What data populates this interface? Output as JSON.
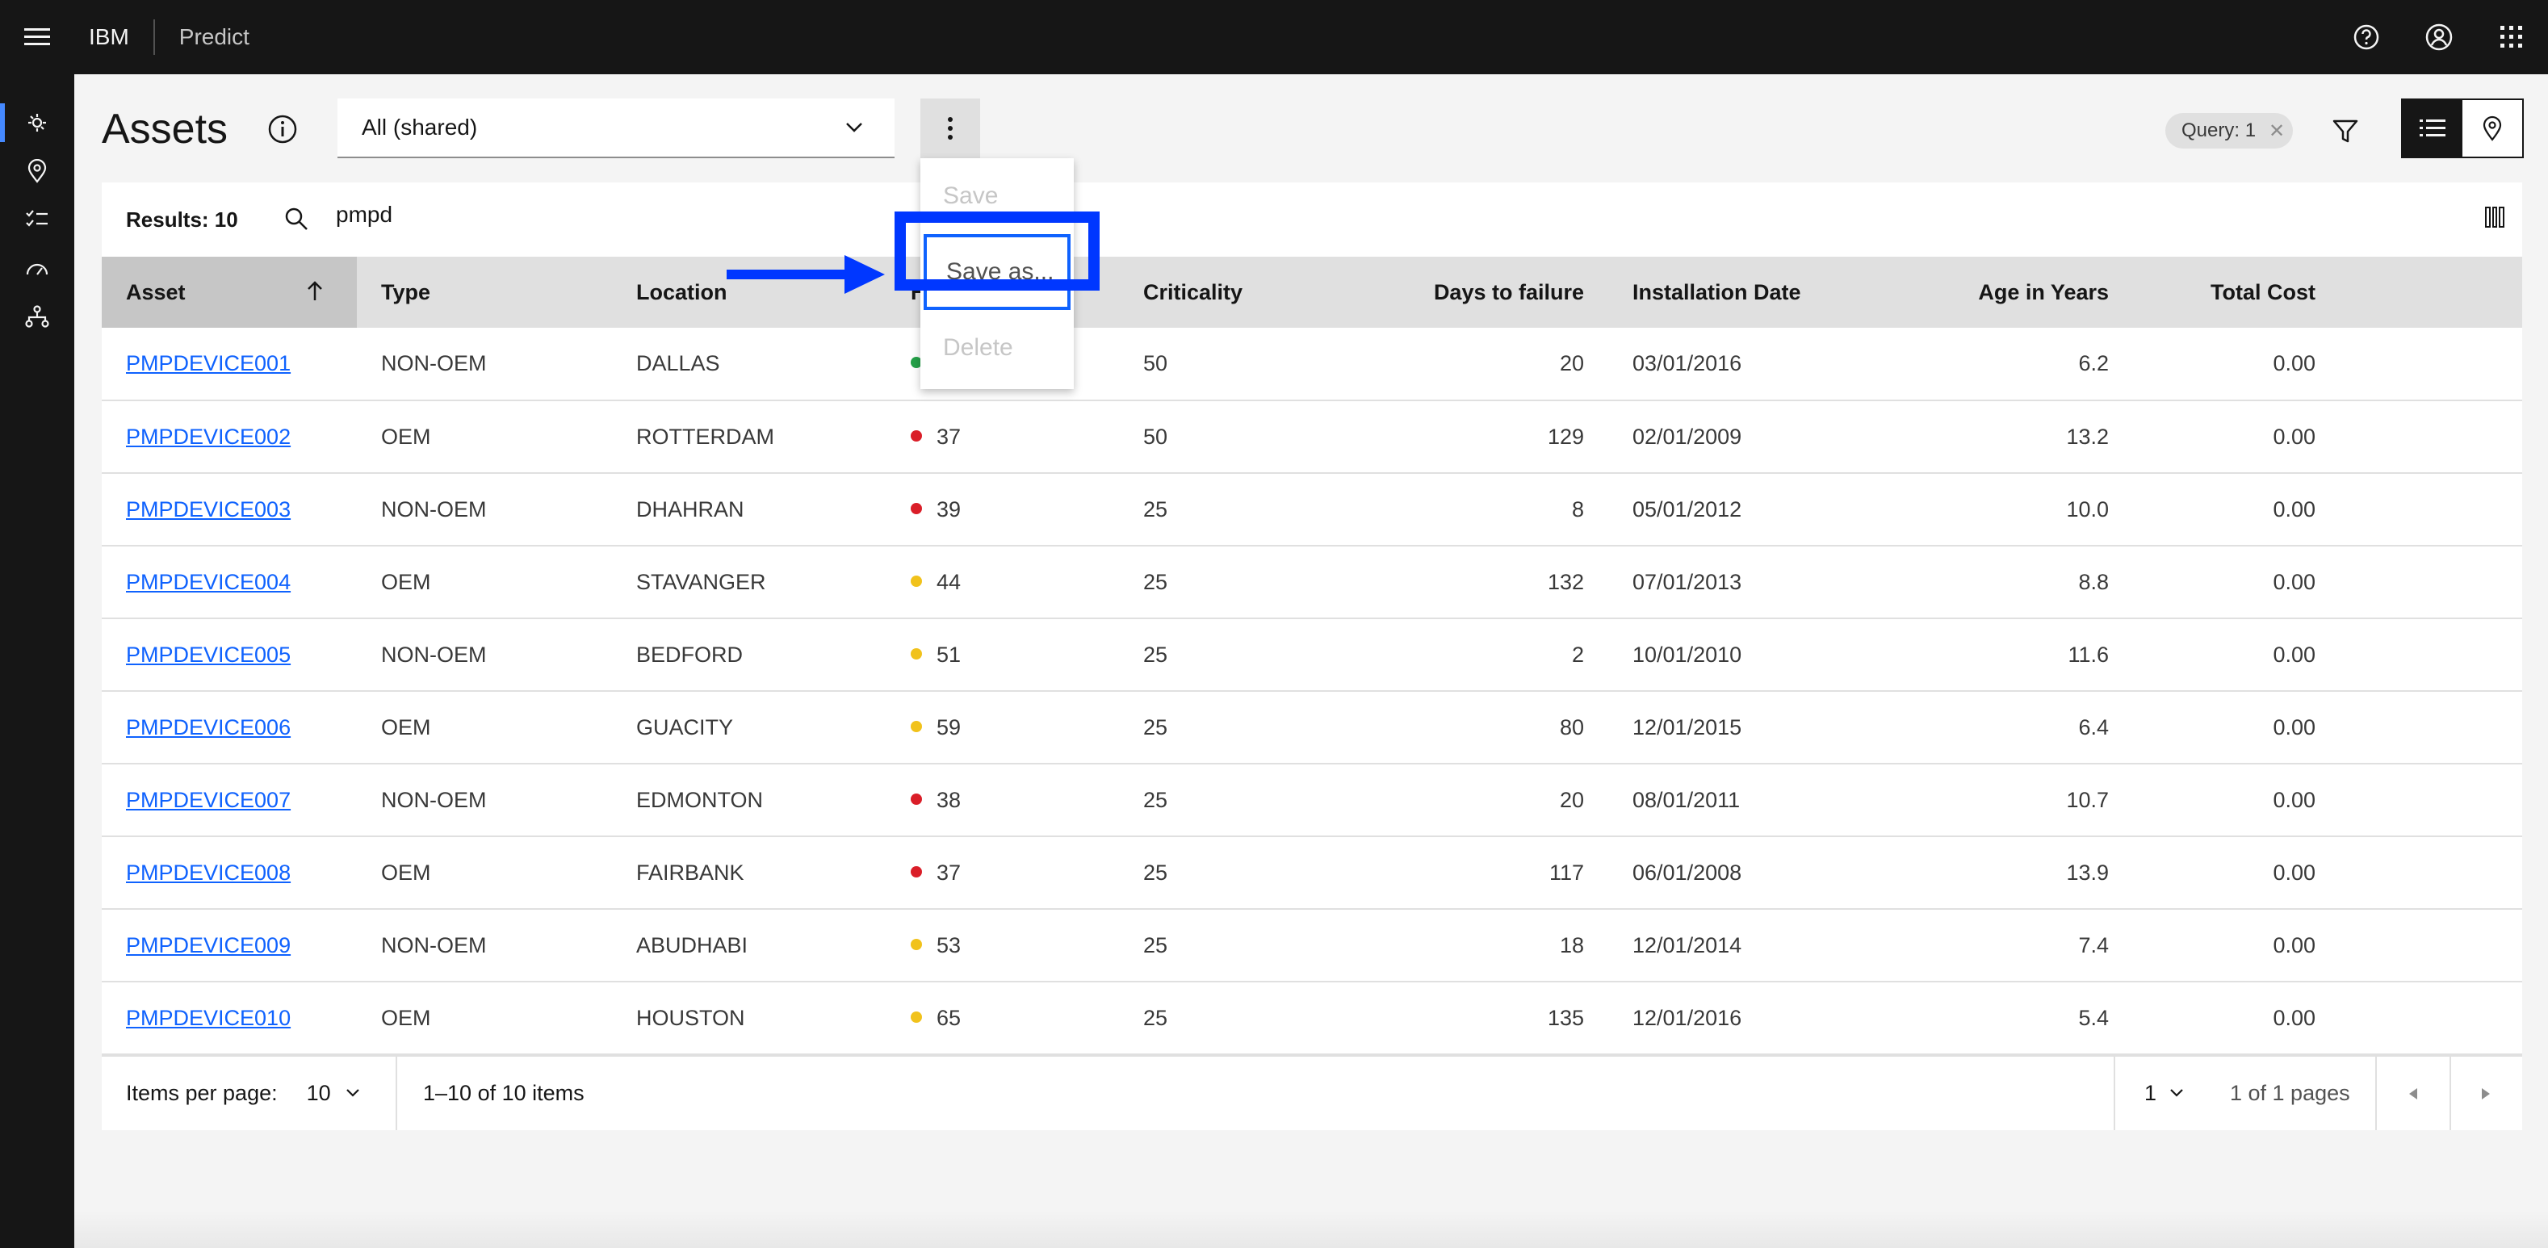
{
  "topbar": {
    "brand": "IBM",
    "product": "Predict",
    "icons": [
      "menu-icon",
      "help-icon",
      "user-icon",
      "app-switcher-icon"
    ]
  },
  "sidenav": {
    "icons": [
      "assets-icon",
      "location-icon",
      "checklist-icon",
      "gauge-icon",
      "hierarchy-icon"
    ]
  },
  "page": {
    "title": "Assets"
  },
  "view_select": {
    "value": "All (shared)"
  },
  "overflow_menu": {
    "items": [
      "Save",
      "Save as...",
      "Delete"
    ]
  },
  "query_tag": {
    "label": "Query: 1"
  },
  "toolbar": {
    "results": "Results: 10",
    "search_value": "pmpd"
  },
  "table": {
    "headers": [
      "Asset",
      "Type",
      "Location",
      "Health",
      "Criticality",
      "Days to failure",
      "Installation Date",
      "Age in Years",
      "Total Cost"
    ],
    "rows": [
      {
        "asset": "PMPDEVICE001",
        "type": "NON-OEM",
        "location": "DALLAS",
        "health": "",
        "status": "green",
        "criticality": "50",
        "days": "20",
        "date": "03/01/2016",
        "age": "6.2",
        "cost": "0.00"
      },
      {
        "asset": "PMPDEVICE002",
        "type": "OEM",
        "location": "ROTTERDAM",
        "health": "37",
        "status": "red",
        "criticality": "50",
        "days": "129",
        "date": "02/01/2009",
        "age": "13.2",
        "cost": "0.00"
      },
      {
        "asset": "PMPDEVICE003",
        "type": "NON-OEM",
        "location": "DHAHRAN",
        "health": "39",
        "status": "red",
        "criticality": "25",
        "days": "8",
        "date": "05/01/2012",
        "age": "10.0",
        "cost": "0.00"
      },
      {
        "asset": "PMPDEVICE004",
        "type": "OEM",
        "location": "STAVANGER",
        "health": "44",
        "status": "yellow",
        "criticality": "25",
        "days": "132",
        "date": "07/01/2013",
        "age": "8.8",
        "cost": "0.00"
      },
      {
        "asset": "PMPDEVICE005",
        "type": "NON-OEM",
        "location": "BEDFORD",
        "health": "51",
        "status": "yellow",
        "criticality": "25",
        "days": "2",
        "date": "10/01/2010",
        "age": "11.6",
        "cost": "0.00"
      },
      {
        "asset": "PMPDEVICE006",
        "type": "OEM",
        "location": "GUACITY",
        "health": "59",
        "status": "yellow",
        "criticality": "25",
        "days": "80",
        "date": "12/01/2015",
        "age": "6.4",
        "cost": "0.00"
      },
      {
        "asset": "PMPDEVICE007",
        "type": "NON-OEM",
        "location": "EDMONTON",
        "health": "38",
        "status": "red",
        "criticality": "25",
        "days": "20",
        "date": "08/01/2011",
        "age": "10.7",
        "cost": "0.00"
      },
      {
        "asset": "PMPDEVICE008",
        "type": "OEM",
        "location": "FAIRBANK",
        "health": "37",
        "status": "red",
        "criticality": "25",
        "days": "117",
        "date": "06/01/2008",
        "age": "13.9",
        "cost": "0.00"
      },
      {
        "asset": "PMPDEVICE009",
        "type": "NON-OEM",
        "location": "ABUDHABI",
        "health": "53",
        "status": "yellow",
        "criticality": "25",
        "days": "18",
        "date": "12/01/2014",
        "age": "7.4",
        "cost": "0.00"
      },
      {
        "asset": "PMPDEVICE010",
        "type": "OEM",
        "location": "HOUSTON",
        "health": "65",
        "status": "yellow",
        "criticality": "25",
        "days": "135",
        "date": "12/01/2016",
        "age": "5.4",
        "cost": "0.00"
      }
    ]
  },
  "pagination": {
    "items_per_page_label": "Items per page:",
    "items_per_page": "10",
    "range": "1–10 of 10 items",
    "page": "1",
    "page_of": "1 of 1 pages"
  },
  "colors": {
    "status_red": "#da1e28",
    "status_yellow": "#f1c21b",
    "status_green": "#24a148",
    "annotation_blue": "#0037ff",
    "link": "#0f62fe"
  }
}
